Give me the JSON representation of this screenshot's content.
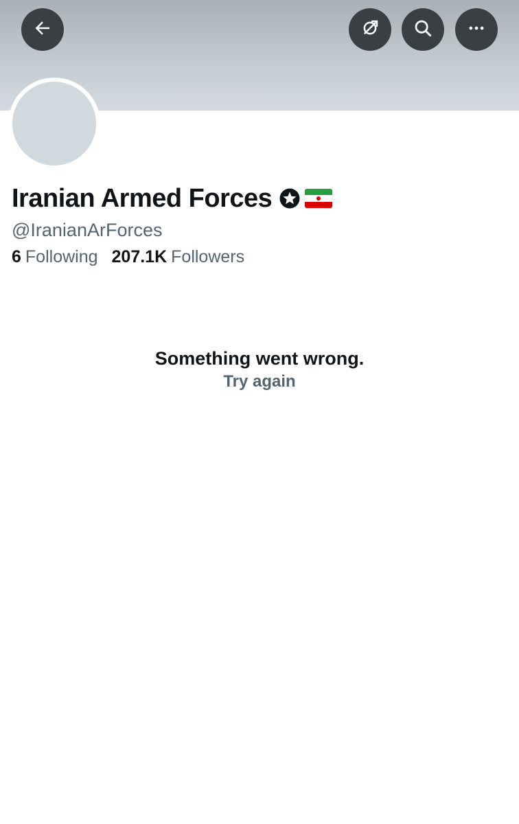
{
  "header": {
    "back_icon": "arrow-left-icon",
    "mute_icon": "mute-notifications-icon",
    "search_icon": "search-icon",
    "more_icon": "more-dots-icon",
    "banner_color": "#c3cad0",
    "button_color": "#3a3f44"
  },
  "profile": {
    "display_name": "Iranian Armed Forces",
    "badge_icon": "star-badge-icon",
    "flag_icon": "iran-flag-icon",
    "handle": "@IranianArForces",
    "following_count": "6",
    "following_label": "Following",
    "followers_count": "207.1K",
    "followers_label": "Followers",
    "avatar_color": "#cfd9de"
  },
  "error": {
    "message": "Something went wrong.",
    "retry_label": "Try again"
  },
  "colors": {
    "text_primary": "#0f1419",
    "text_secondary": "#536471"
  }
}
